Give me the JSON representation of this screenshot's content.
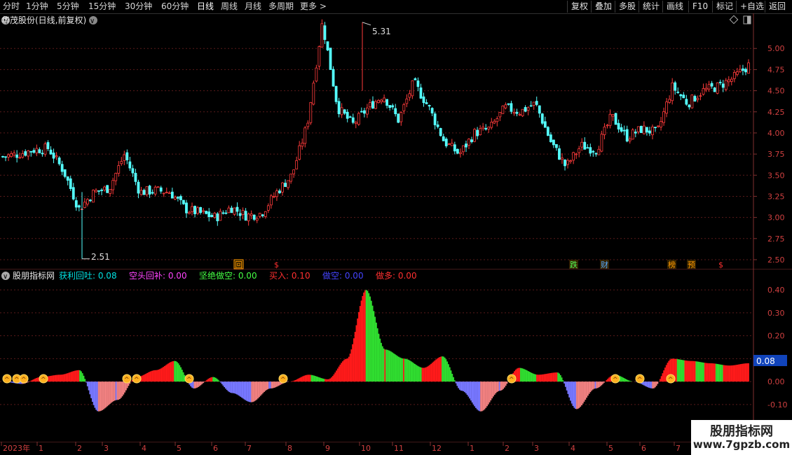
{
  "toolbar": {
    "periods": [
      "分时",
      "1分钟",
      "5分钟",
      "15分钟",
      "30分钟",
      "60分钟",
      "日线",
      "周线",
      "月线",
      "多周期",
      "更多 >"
    ],
    "active_period": "日线",
    "actions": [
      "复权",
      "叠加",
      "多股",
      "统计",
      "画线",
      "F10",
      "标记",
      "+自选",
      "返回"
    ]
  },
  "main_chart": {
    "title": "华茂股份(日线,前复权)",
    "high_label": "5.31",
    "low_label": "2.51",
    "y_ticks": [
      "5.00",
      "4.75",
      "4.50",
      "4.25",
      "4.00",
      "3.75",
      "3.50",
      "3.25",
      "3.00",
      "2.75",
      "2.50"
    ],
    "price_data": {
      "type": "candlestick",
      "y_range": [
        2.45,
        5.35
      ],
      "dates": [
        "2023-01",
        "2023-02",
        "2023-03",
        "2023-04",
        "2023-05",
        "2023-06",
        "2023-07",
        "2023-08",
        "2023-09",
        "2023-10",
        "2023-11",
        "2023-12",
        "2024-01",
        "2024-02",
        "2024-03",
        "2024-04",
        "2024-05",
        "2024-06",
        "2024-07"
      ],
      "close_trend": [
        3.72,
        3.75,
        3.8,
        3.82,
        3.55,
        3.1,
        3.3,
        3.35,
        3.75,
        3.3,
        3.32,
        3.3,
        3.1,
        3.05,
        3.0,
        3.12,
        3.02,
        3.05,
        3.3,
        3.5,
        4.1,
        5.31,
        4.3,
        4.1,
        4.3,
        4.45,
        4.15,
        4.6,
        4.3,
        3.9,
        3.75,
        4.0,
        4.05,
        4.3,
        4.25,
        4.35,
        3.9,
        3.6,
        3.85,
        3.8,
        4.2,
        3.95,
        4.05,
        4.0,
        4.55,
        4.35,
        4.5,
        4.55,
        4.65,
        4.8
      ],
      "high": 5.31,
      "low": 2.51
    },
    "markers": [
      {
        "text": "回",
        "color": "#ff9900"
      },
      {
        "text": "$",
        "color": "#ff3030"
      },
      {
        "text": "跌",
        "color": "#55ff55"
      },
      {
        "text": "财",
        "color": "#55aaff"
      },
      {
        "text": "榜",
        "color": "#ff9900"
      },
      {
        "text": "预",
        "color": "#ff9900"
      },
      {
        "text": "$",
        "color": "#ff3030"
      }
    ]
  },
  "indicator": {
    "name": "股朋指标网",
    "legend": [
      {
        "label": "获利回吐:",
        "value": "0.08",
        "color": "#00e0e0"
      },
      {
        "label": "空头回补:",
        "value": "0.00",
        "color": "#ff44ff"
      },
      {
        "label": "坚绝做空:",
        "value": "0.00",
        "color": "#44ff44"
      },
      {
        "label": "买入:",
        "value": "0.10",
        "color": "#ff3030"
      },
      {
        "label": "做空:",
        "value": "0.00",
        "color": "#4444ff"
      },
      {
        "label": "做多:",
        "value": "0.00",
        "color": "#ff3030"
      }
    ],
    "y_ticks": [
      "0.40",
      "0.30",
      "0.20",
      "0.10",
      "0.00",
      "-0.10"
    ],
    "current_value": "0.08",
    "chart_data": {
      "type": "area",
      "y_range": [
        -0.14,
        0.44
      ],
      "values": [
        0.0,
        -0.01,
        0.02,
        0.03,
        0.05,
        -0.13,
        -0.08,
        0.02,
        0.05,
        0.09,
        -0.03,
        0.02,
        -0.05,
        -0.09,
        -0.03,
        0.0,
        0.03,
        0.01,
        0.1,
        0.4,
        0.14,
        0.1,
        0.06,
        0.11,
        -0.04,
        -0.13,
        -0.04,
        0.06,
        0.03,
        0.04,
        -0.12,
        -0.03,
        0.03,
        0.0,
        -0.03,
        0.1,
        0.09,
        0.08,
        0.07,
        0.08
      ]
    },
    "signal_count": 13
  },
  "x_axis": [
    "2023年",
    "1",
    "2",
    "3",
    "4",
    "5",
    "6",
    "7",
    "8",
    "9",
    "10",
    "11",
    "12",
    "1",
    "2",
    "3",
    "4",
    "5",
    "6",
    "7"
  ],
  "watermark": {
    "title": "股朋指标网",
    "url": "www.7gpzb.com"
  }
}
